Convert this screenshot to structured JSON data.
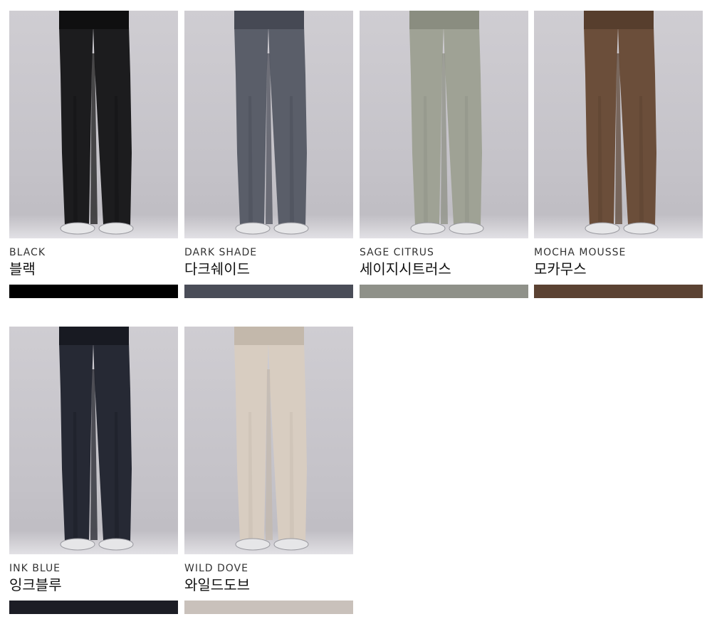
{
  "products": [
    {
      "name_en": "BLACK",
      "name_ko": "블랙",
      "color": "#000000",
      "pants": "#1c1c1e",
      "shade": "#0f0f10"
    },
    {
      "name_en": "DARK SHADE",
      "name_ko": "다크쉐이드",
      "color": "#4a4d58",
      "pants": "#5a5e69",
      "shade": "#464954"
    },
    {
      "name_en": "SAGE CITRUS",
      "name_ko": "세이지시트러스",
      "color": "#8f9189",
      "pants": "#9fa295",
      "shade": "#8a8d80"
    },
    {
      "name_en": "MOCHA MOUSSE",
      "name_ko": "모카무스",
      "color": "#5b4232",
      "pants": "#6b4e3a",
      "shade": "#573e2d"
    },
    {
      "name_en": "INK BLUE",
      "name_ko": "잉크블루",
      "color": "#1c1d25",
      "pants": "#262934",
      "shade": "#181a22"
    },
    {
      "name_en": "WILD DOVE",
      "name_ko": "와일드도브",
      "color": "#c9c1bb",
      "pants": "#d8cdc1",
      "shade": "#c3b8ab"
    }
  ]
}
